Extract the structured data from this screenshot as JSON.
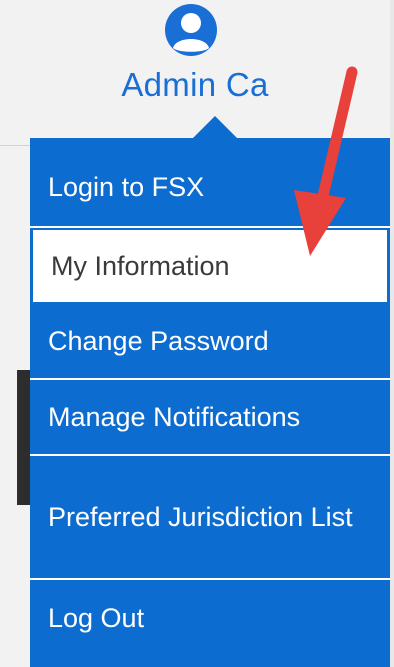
{
  "user": {
    "name": "Admin Ca",
    "icon": "user-avatar-icon"
  },
  "menu": {
    "items": [
      {
        "label": "Login to FSX"
      },
      {
        "label": "My Information",
        "state": "highlighted"
      },
      {
        "label": "Change Password"
      },
      {
        "label": "Manage Notifications"
      },
      {
        "label": "Preferred Jurisdiction List"
      },
      {
        "label": "Log Out"
      }
    ]
  },
  "colors": {
    "accent": "#1a6fd6",
    "menu_background": "#0d6cd0",
    "selected_background": "#ffffff",
    "annotation": "#e8403a"
  },
  "annotation": {
    "type": "arrow",
    "points_to": "My Information"
  }
}
